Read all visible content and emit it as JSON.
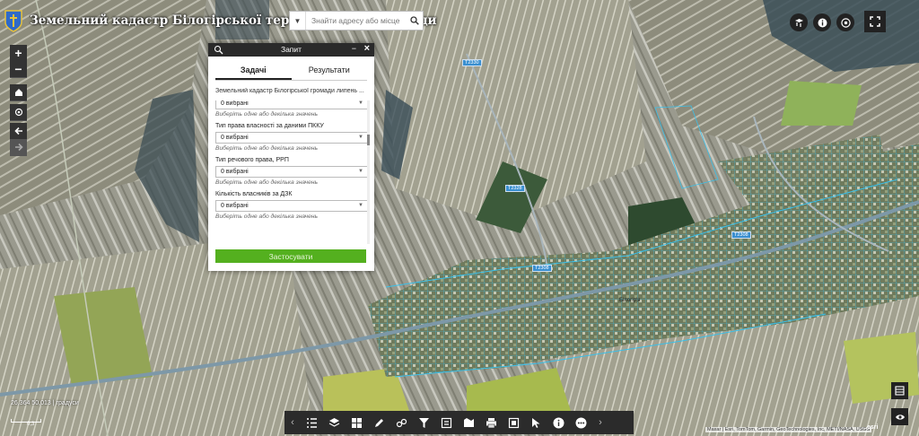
{
  "header": {
    "title": "Земельний кадастр Білогірської територіальної громади",
    "search_placeholder": "Знайти адресу або місце"
  },
  "query_panel": {
    "title": "Запит",
    "tabs": [
      "Задачі",
      "Результати"
    ],
    "task_name": "Земельний кадастр Білогірської громади липень ...",
    "fields": [
      {
        "label": "",
        "value": "0 вибрані",
        "hint": "Виберіть одне або декілька значень"
      },
      {
        "label": "Тип права власності за даними ПККУ",
        "value": "0 вибрані",
        "hint": "Виберіть одне або декілька значень"
      },
      {
        "label": "Тип речового права, РРП",
        "value": "0 вибрані",
        "hint": "Виберіть одне або декілька значень"
      },
      {
        "label": "Кількість власників за ДЗК",
        "value": "0 вибрані",
        "hint": "Виберіть одне або декілька значень"
      }
    ],
    "apply_label": "Застосувати"
  },
  "map": {
    "coordinates": "26,364 50,013 | градуси",
    "scale": "0,3",
    "attribution": "Maxar | Esri, TomTom, Garmin, GeoTechnologies, Inc, METI/NASA, USGS",
    "esri_logo": "esri",
    "place_label": "Білогір'я",
    "road_shields": [
      "Т2330",
      "Т2328",
      "Т2308",
      "Т2308"
    ]
  },
  "icons": {
    "top_tools": [
      "layers-list-icon",
      "info-icon",
      "basemap-gallery-icon",
      "fullscreen-icon"
    ],
    "left_controls": [
      "zoom-in-icon",
      "zoom-out-icon",
      "home-icon",
      "my-location-icon",
      "back-arrow-icon",
      "forward-arrow-icon"
    ],
    "toolbar": [
      "legend-icon",
      "layers-icon",
      "basemap-icon",
      "draw-icon",
      "analysis-icon",
      "filter-icon",
      "edit-icon",
      "bookmark-icon",
      "print-icon",
      "screening-icon",
      "select-icon",
      "about-icon",
      "more-icon"
    ]
  },
  "colors": {
    "apply_button": "#54b01f",
    "dark_ui": "#2b2b2b",
    "parcel_outline": "#39c0ea"
  }
}
